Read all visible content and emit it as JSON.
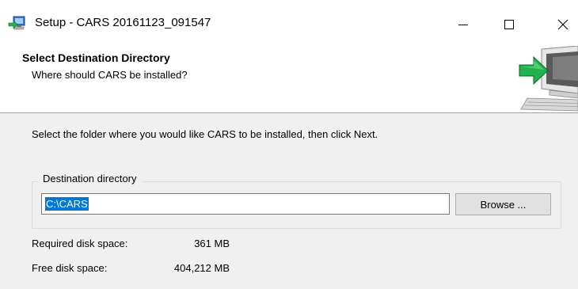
{
  "window": {
    "title": "Setup - CARS 20161123_091547",
    "icons": {
      "app": "setup-computer-icon",
      "minimize": "minimize-icon",
      "maximize": "maximize-icon",
      "close": "close-icon"
    }
  },
  "header": {
    "title": "Select Destination Directory",
    "subtitle": "Where should CARS be installed?",
    "image": "install-computer-arrow-icon"
  },
  "content": {
    "instruction": "Select the folder where you would like CARS to be installed, then click Next.",
    "destination": {
      "group_label": "Destination directory",
      "path_value": "C:\\CARS",
      "browse_label": "Browse ..."
    },
    "disk": {
      "required_label": "Required disk space:",
      "required_value": "361 MB",
      "free_label": "Free disk space:",
      "free_value": "404,212 MB"
    }
  },
  "colors": {
    "selection": "#0078d7",
    "panel": "#f0f0f0",
    "button": "#e1e1e1",
    "arrow": "#22b14c"
  }
}
